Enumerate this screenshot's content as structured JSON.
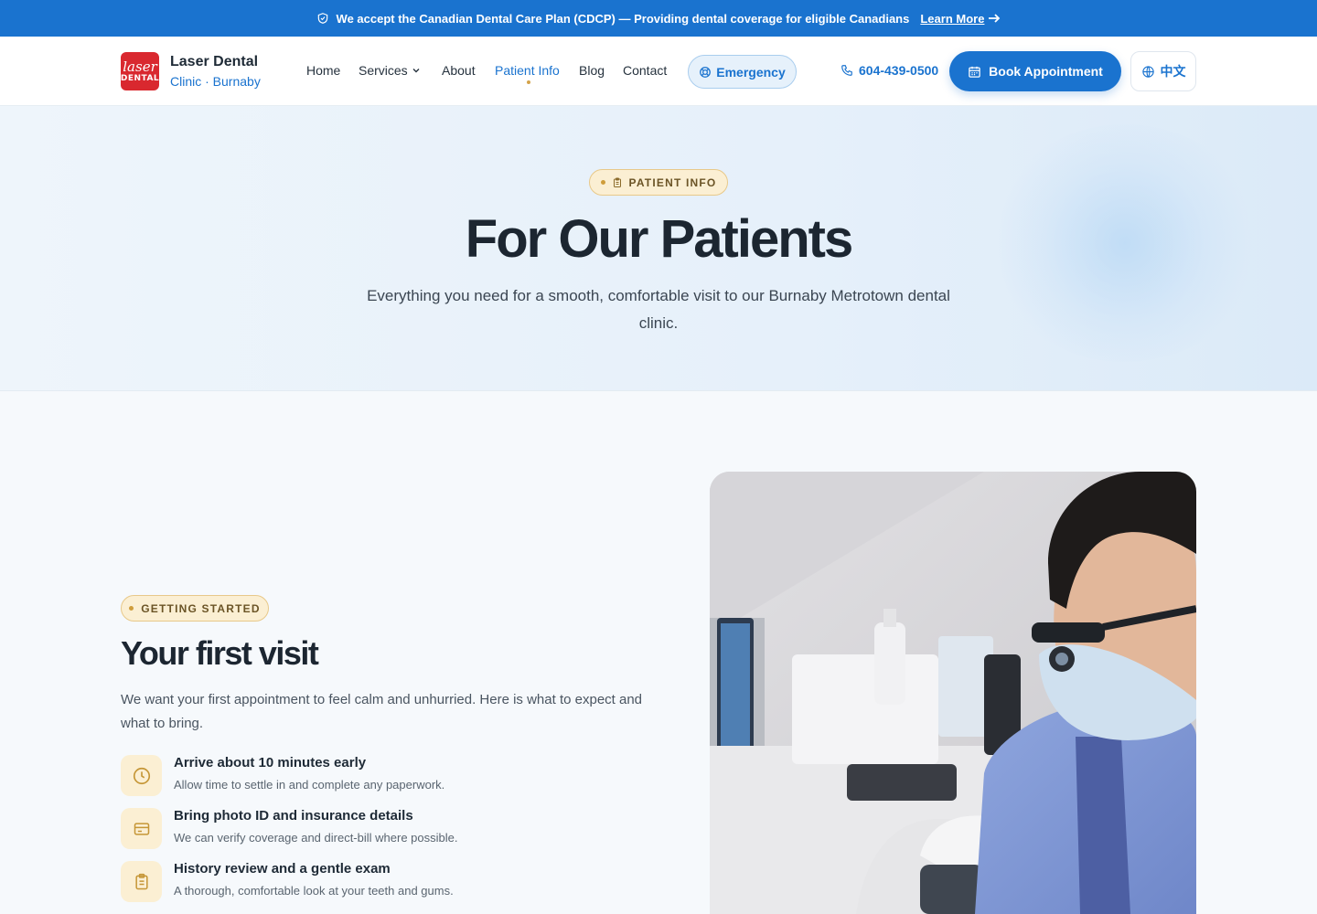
{
  "announcement": {
    "text": "We accept the Canadian Dental Care Plan (CDCP) — Providing dental coverage for eligible Canadians",
    "link_label": "Learn More",
    "icon": "shield-check-icon"
  },
  "brand": {
    "logo_line1": "laser",
    "logo_line2": "DENTAL",
    "name": "Laser Dental",
    "subtitle": "Clinic · Burnaby"
  },
  "nav": {
    "items": [
      {
        "label": "Home"
      },
      {
        "label": "Services"
      },
      {
        "label": "About"
      },
      {
        "label": "Patient Info",
        "active": true
      },
      {
        "label": "Blog"
      },
      {
        "label": "Contact"
      }
    ],
    "emergency_label": "Emergency",
    "phone": "604-439-0500",
    "book_label": "Book Appointment",
    "lang_label": "中文"
  },
  "hero": {
    "badge": "PATIENT INFO",
    "title": "For Our Patients",
    "subtitle": "Everything you need for a smooth, comfortable visit to our Burnaby Metrotown dental clinic."
  },
  "first_visit": {
    "badge": "GETTING STARTED",
    "title": "Your first visit",
    "intro": "We want your first appointment to feel calm and unhurried. Here is what to expect and what to bring.",
    "steps": [
      {
        "title": "Arrive about 10 minutes early",
        "desc": "Allow time to settle in and complete any paperwork.",
        "icon": "clock-icon"
      },
      {
        "title": "Bring photo ID and insurance details",
        "desc": "We can verify coverage and direct-bill where possible.",
        "icon": "id-card-icon"
      },
      {
        "title": "History review and a gentle exam",
        "desc": "A thorough, comfortable look at your teeth and gums.",
        "icon": "clipboard-icon"
      }
    ]
  },
  "colors": {
    "primary": "#1a73cf",
    "accent_gold": "#cf9d3b",
    "logo_red": "#d9282f"
  }
}
